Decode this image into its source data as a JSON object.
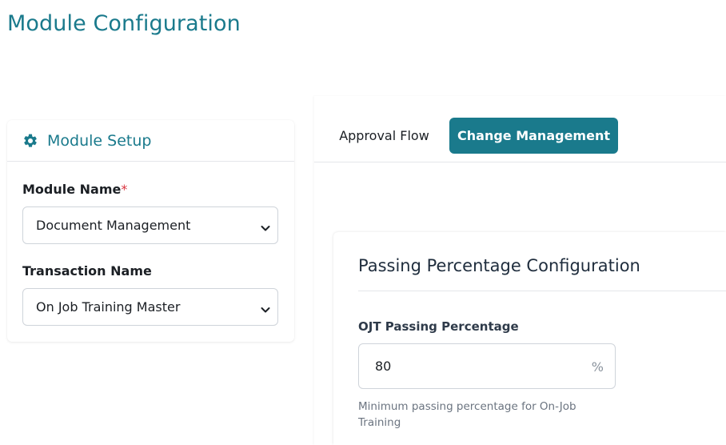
{
  "page": {
    "title": "Module Configuration"
  },
  "module_setup": {
    "title": "Module Setup",
    "icon": "gear-icon",
    "module_name_label": "Module Name",
    "required_mark": "*",
    "module_name_value": "Document Management",
    "transaction_name_label": "Transaction Name",
    "transaction_name_value": "On Job Training Master"
  },
  "tabs": [
    {
      "label": "Approval Flow",
      "active": false
    },
    {
      "label": "Change Management",
      "active": true
    }
  ],
  "passing_config": {
    "title": "Passing Percentage Configuration",
    "ojt_label": "OJT Passing Percentage",
    "ojt_value": "80",
    "unit": "%",
    "helper_line1": "Minimum passing percentage for On-Job",
    "helper_line2": "Training"
  },
  "colors": {
    "accent": "#1a7a8c",
    "required": "#d9343f"
  }
}
